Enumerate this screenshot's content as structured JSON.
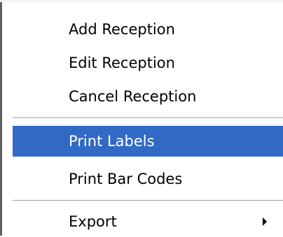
{
  "menu": {
    "items": [
      {
        "label": "Add Reception"
      },
      {
        "label": "Edit Reception"
      },
      {
        "label": "Cancel Reception"
      },
      {
        "label": "Print Labels",
        "highlighted": true
      },
      {
        "label": "Print Bar Codes"
      },
      {
        "label": "Export",
        "has_submenu": true,
        "submenu_icon": "chevron-right-icon"
      }
    ]
  },
  "colors": {
    "highlight": "#316ac5",
    "highlight_text": "#ffffff",
    "text": "#000000",
    "background": "#ffffff"
  }
}
